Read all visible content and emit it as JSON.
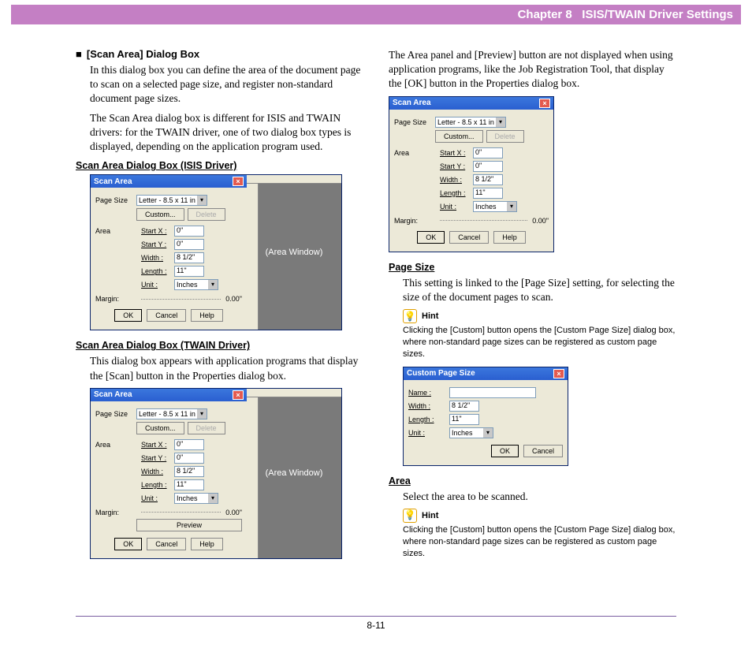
{
  "header": {
    "chapter": "Chapter 8",
    "title": "ISIS/TWAIN Driver Settings"
  },
  "left": {
    "section_title": "[Scan Area] Dialog Box",
    "p1": "In this dialog box you can define the area of the document page to scan on a selected page size, and register non-standard document page sizes.",
    "p2": "The Scan Area dialog box is different for ISIS and TWAIN drivers: for the TWAIN driver, one of two dialog box types is displayed, depending on the application program used.",
    "h_isis": "Scan Area Dialog Box (ISIS Driver)",
    "h_twain": "Scan Area Dialog Box (TWAIN Driver)",
    "twain_p": "This dialog box appears with application programs that display the [Scan] button in the Properties dialog box."
  },
  "right": {
    "p1": "The Area panel and [Preview] button are not displayed when using application programs, like the Job Registration Tool, that display the [OK] button in the Properties dialog box.",
    "h_pagesize": "Page Size",
    "pagesize_p": "This setting is linked to the [Page Size] setting, for selecting the size of the document pages to scan.",
    "hint_label": "Hint",
    "hint1": "Clicking the [Custom] button opens the [Custom Page Size] dialog box, where non-standard page sizes can be registered as custom page sizes.",
    "h_area": "Area",
    "area_p": "Select the area to be scanned.",
    "hint2": "Clicking the [Custom] button opens the [Custom Page Size] dialog box, where non-standard page sizes can be registered as custom page sizes."
  },
  "dialog": {
    "title": "Scan Area",
    "page_size": "Page Size",
    "page_size_val": "Letter - 8.5 x 11 in",
    "custom": "Custom...",
    "delete": "Delete",
    "area": "Area",
    "startx": "Start X :",
    "starty": "Start Y :",
    "width": "Width :",
    "length": "Length :",
    "unit": "Unit :",
    "v0": "0\"",
    "v85": "8 1/2\"",
    "v11": "11\"",
    "inches": "Inches",
    "margin": "Margin:",
    "margin_v": "0.00\"",
    "ok": "OK",
    "cancel": "Cancel",
    "help": "Help",
    "preview": "Preview",
    "area_window": "(Area Window)"
  },
  "custom_dialog": {
    "title": "Custom Page Size",
    "name": "Name :",
    "name_v": "",
    "width": "Width :",
    "width_v": "8 1/2\"",
    "length": "Length :",
    "length_v": "11\"",
    "unit": "Unit :",
    "unit_v": "Inches",
    "ok": "OK",
    "cancel": "Cancel"
  },
  "footer": {
    "page": "8-11"
  }
}
